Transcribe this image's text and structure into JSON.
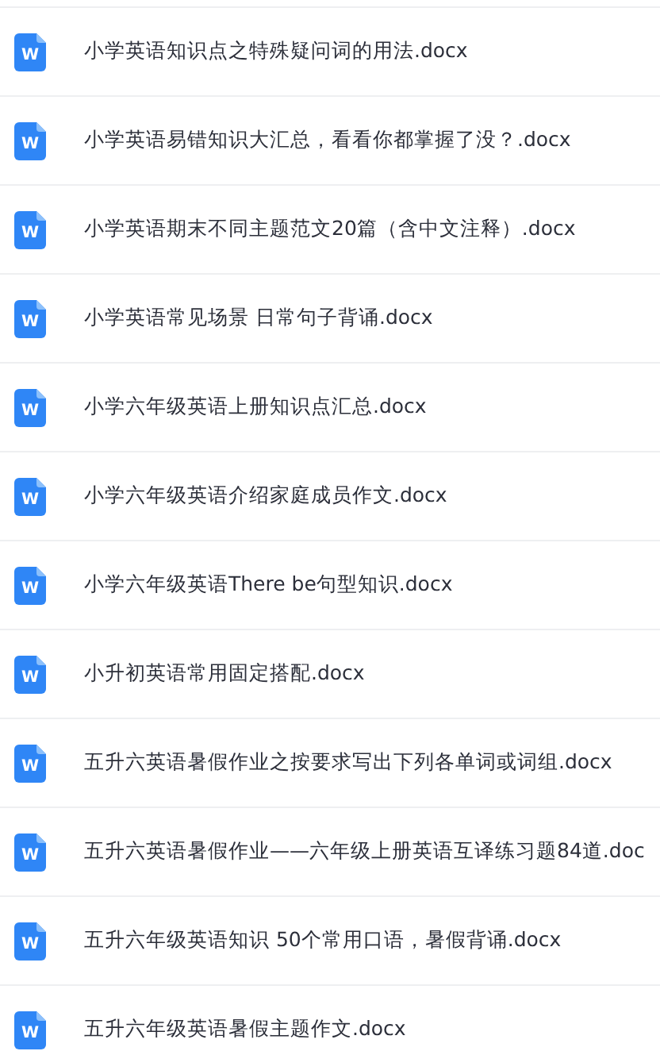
{
  "files": [
    {
      "icon_label": "W",
      "name": "小学英语知识点之特殊疑问词的用法.docx"
    },
    {
      "icon_label": "W",
      "name": "小学英语易错知识大汇总，看看你都掌握了没？.docx"
    },
    {
      "icon_label": "W",
      "name": "小学英语期末不同主题范文20篇（含中文注释）.docx"
    },
    {
      "icon_label": "W",
      "name": "小学英语常见场景 日常句子背诵.docx"
    },
    {
      "icon_label": "W",
      "name": "小学六年级英语上册知识点汇总.docx"
    },
    {
      "icon_label": "W",
      "name": "小学六年级英语介绍家庭成员作文.docx"
    },
    {
      "icon_label": "W",
      "name": "小学六年级英语There be句型知识.docx"
    },
    {
      "icon_label": "W",
      "name": "小升初英语常用固定搭配.docx"
    },
    {
      "icon_label": "W",
      "name": "五升六英语暑假作业之按要求写出下列各单词或词组.docx"
    },
    {
      "icon_label": "W",
      "name": "五升六英语暑假作业——六年级上册英语互译练习题84道.doc"
    },
    {
      "icon_label": "W",
      "name": "五升六年级英语知识 50个常用口语，暑假背诵.docx"
    },
    {
      "icon_label": "W",
      "name": "五升六年级英语暑假主题作文.docx"
    }
  ]
}
